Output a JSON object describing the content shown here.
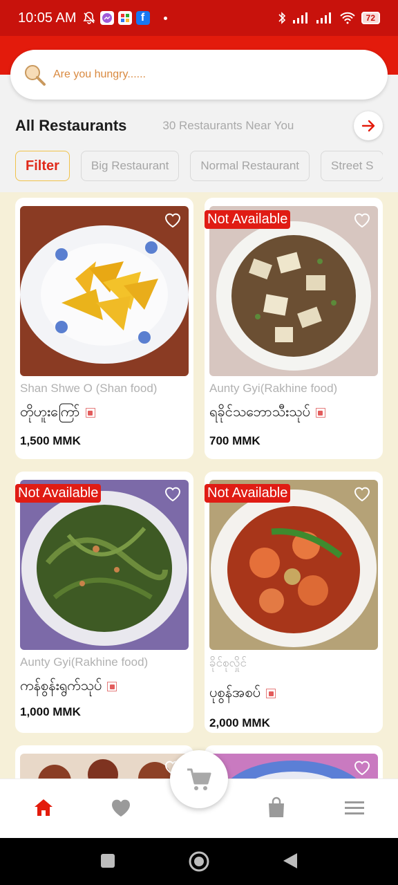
{
  "status_bar": {
    "time": "10:05 AM",
    "battery": "72"
  },
  "search": {
    "placeholder": "Are you hungry......"
  },
  "header": {
    "title": "All Restaurants",
    "near_count": "30 Restaurants Near You"
  },
  "filters": [
    {
      "label": "Filter",
      "active": true
    },
    {
      "label": "Big Restaurant",
      "active": false
    },
    {
      "label": "Normal Restaurant",
      "active": false
    },
    {
      "label": "Street S",
      "active": false
    }
  ],
  "badge_text": "Not Available",
  "cards": [
    {
      "restaurant": "Shan Shwe O (Shan food)",
      "dish": "တိုဟူးကြော်",
      "price": "1,500 MMK",
      "available": true
    },
    {
      "restaurant": "Aunty Gyi(Rakhine food)",
      "dish": "ရခိုင်သဘောသီးသုပ်",
      "price": "700 MMK",
      "available": false
    },
    {
      "restaurant": "Aunty Gyi(Rakhine food)",
      "dish": "ကန်စွန်းရွက်သုပ်",
      "price": "1,000 MMK",
      "available": false
    },
    {
      "restaurant": "ခိုင်စုလှိုင်",
      "dish": "ပုစွန်အစပ်",
      "price": "2,000 MMK",
      "available": false
    }
  ],
  "colors": {
    "brand_red": "#e31b0c",
    "status_red": "#c8120c",
    "cream_bg": "#f6f0d8",
    "icon_gray": "#9a9a9a"
  },
  "icons": {
    "nav": [
      "home-icon",
      "heart-icon",
      "cart-icon",
      "bag-icon",
      "menu-icon"
    ]
  }
}
